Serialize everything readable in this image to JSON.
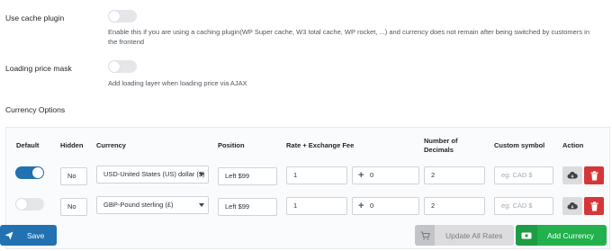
{
  "settings": {
    "use_cache": {
      "label": "Use cache plugin",
      "enabled": false,
      "description": "Enable this if you are using a caching plugin(WP Super cache, W3 total cache, WP rocket, ...) and currency does not remain after being switched by customers in the frontend"
    },
    "loading_mask": {
      "label": "Loading price mask",
      "enabled": false,
      "description": "Add loading layer when loading price via AJAX"
    }
  },
  "currency_options": {
    "title": "Currency Options",
    "columns": {
      "default": "Default",
      "hidden": "Hidden",
      "currency": "Currency",
      "position": "Position",
      "rate": "Rate + Exchange Fee",
      "decimals": "Number of Decimals",
      "custom_symbol": "Custom symbol",
      "action": "Action"
    },
    "rows": [
      {
        "default": true,
        "hidden": "No",
        "currency": "USD-United States (US) dollar ($)",
        "position": "Left $99",
        "rate": "1",
        "fee": "0",
        "decimals": "2",
        "custom_symbol_placeholder": "eg: CAD $"
      },
      {
        "default": false,
        "hidden": "No",
        "currency": "GBP-Pound sterling (£)",
        "position": "Left $99",
        "rate": "1",
        "fee": "0",
        "decimals": "2",
        "custom_symbol_placeholder": "eg: CAD $"
      }
    ]
  },
  "buttons": {
    "save": "Save",
    "update_all_rates": "Update All Rates",
    "add_currency": "Add Currency"
  },
  "colors": {
    "primary": "#2271b1",
    "danger": "#d63638",
    "success": "#22b14c",
    "toggle_off": "#e4e6ea"
  },
  "icons": {
    "save": "paper-plane-icon",
    "update": "cart-icon",
    "add": "money-icon",
    "download": "cloud-download-icon",
    "delete": "trash-icon"
  }
}
